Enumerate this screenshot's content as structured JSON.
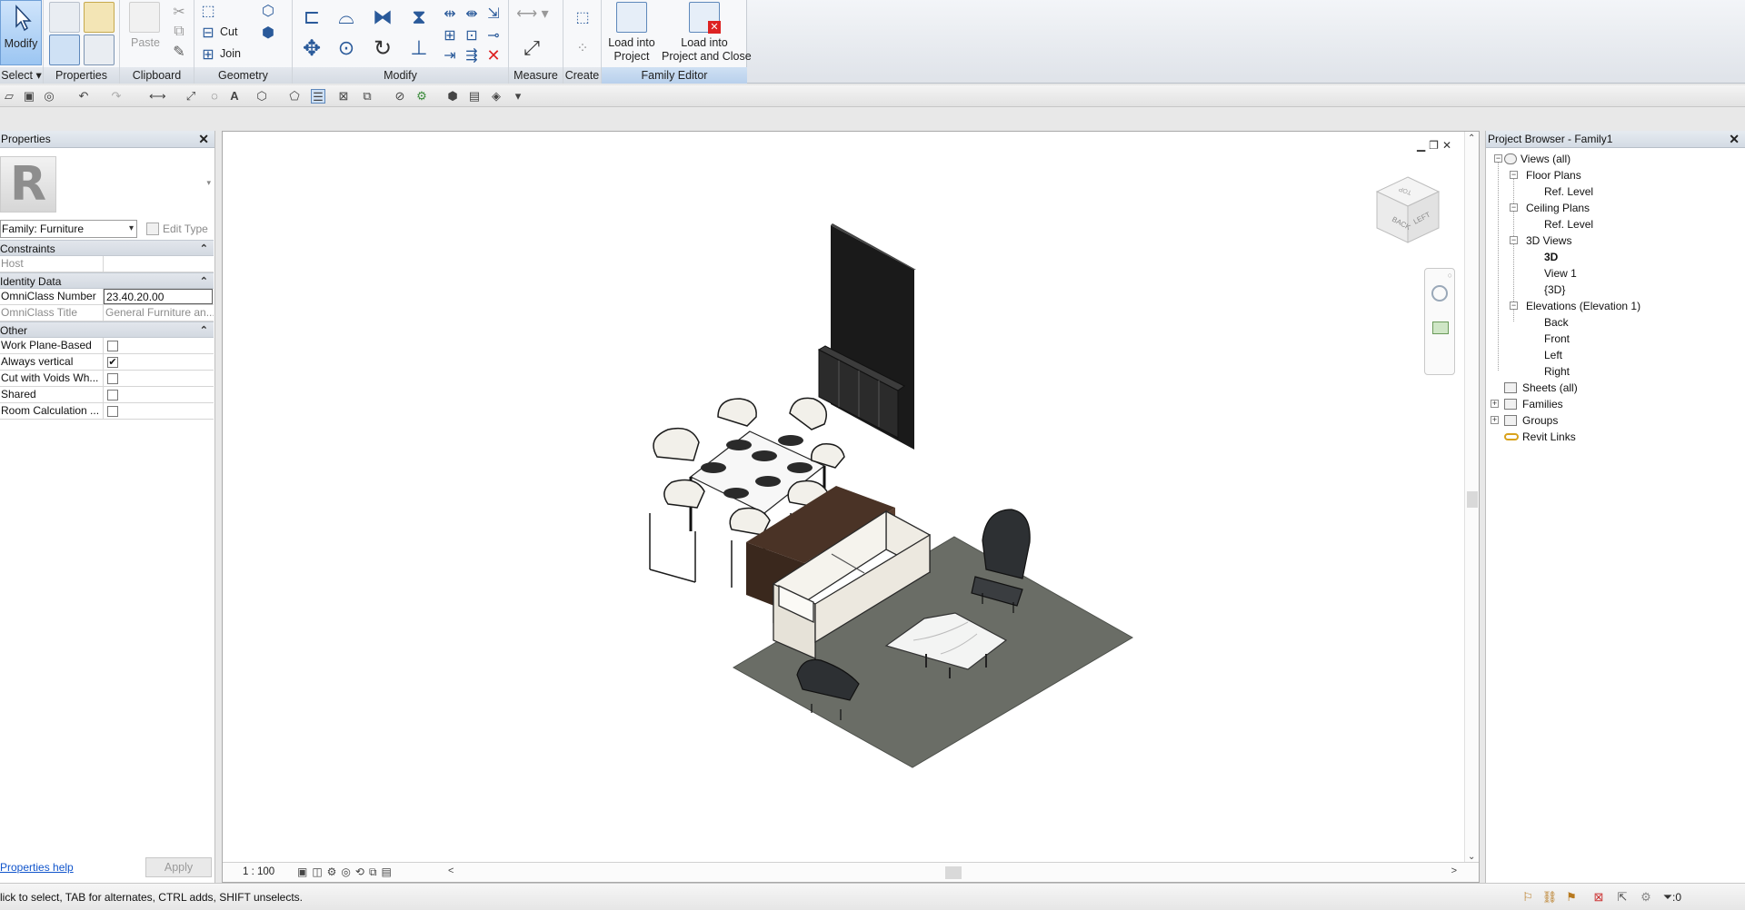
{
  "ribbon": {
    "modify_label": "Modify",
    "select_label": "Select",
    "panels": {
      "properties": "Properties",
      "clipboard": "Clipboard",
      "geometry": "Geometry",
      "modify": "Modify",
      "measure": "Measure",
      "create": "Create",
      "family_editor": "Family Editor"
    },
    "paste_label": "Paste",
    "cut_label": "Cut",
    "join_label": "Join",
    "load_into_project": "Load into\nProject",
    "load_into_project_close": "Load into\nProject and Close"
  },
  "properties": {
    "title": "Properties",
    "type_letter": "R",
    "family_select": "Family: Furniture",
    "edit_type": "Edit Type",
    "groups": [
      {
        "name": "Constraints",
        "rows": [
          {
            "key": "Host",
            "value": "",
            "grey": true
          }
        ]
      },
      {
        "name": "Identity Data",
        "rows": [
          {
            "key": "OmniClass Number",
            "value": "23.40.20.00",
            "editing": true
          },
          {
            "key": "OmniClass Title",
            "value": "General Furniture an...",
            "grey": true
          }
        ]
      },
      {
        "name": "Other",
        "rows": [
          {
            "key": "Work Plane-Based",
            "checkbox": true,
            "checked": false
          },
          {
            "key": "Always vertical",
            "checkbox": true,
            "checked": true
          },
          {
            "key": "Cut with Voids Wh...",
            "checkbox": true,
            "checked": false
          },
          {
            "key": "Shared",
            "checkbox": true,
            "checked": false
          },
          {
            "key": "Room Calculation ...",
            "checkbox": true,
            "checked": false
          }
        ]
      }
    ],
    "help_link": "Properties help",
    "apply_label": "Apply"
  },
  "view": {
    "scale": "1 : 100",
    "viewcube_faces": [
      "BACK",
      "LEFT",
      "TOP"
    ]
  },
  "browser": {
    "title": "Project Browser - Family1",
    "nodes": [
      {
        "label": "Views (all)",
        "level": 0,
        "expander": "-"
      },
      {
        "label": "Floor Plans",
        "level": 1,
        "expander": "-"
      },
      {
        "label": "Ref. Level",
        "level": 2
      },
      {
        "label": "Ceiling Plans",
        "level": 1,
        "expander": "-"
      },
      {
        "label": "Ref. Level",
        "level": 2
      },
      {
        "label": "3D Views",
        "level": 1,
        "expander": "-"
      },
      {
        "label": "3D",
        "level": 2,
        "bold": true
      },
      {
        "label": "View 1",
        "level": 2
      },
      {
        "label": "{3D}",
        "level": 2
      },
      {
        "label": "Elevations (Elevation 1)",
        "level": 1,
        "expander": "-"
      },
      {
        "label": "Back",
        "level": 2
      },
      {
        "label": "Front",
        "level": 2
      },
      {
        "label": "Left",
        "level": 2
      },
      {
        "label": "Right",
        "level": 2
      },
      {
        "label": "Sheets (all)",
        "level": 0
      },
      {
        "label": "Families",
        "level": 0,
        "expander": "+"
      },
      {
        "label": "Groups",
        "level": 0,
        "expander": "+"
      },
      {
        "label": "Revit Links",
        "level": 0
      }
    ]
  },
  "status": {
    "text": "lick to select, TAB for alternates, CTRL adds, SHIFT unselects.",
    "filter_count": ":0"
  },
  "colors": {
    "accent": "#6f9fd6",
    "rug": "#6a6d66",
    "sofa": "#efece4",
    "wood": "#4a3326"
  }
}
